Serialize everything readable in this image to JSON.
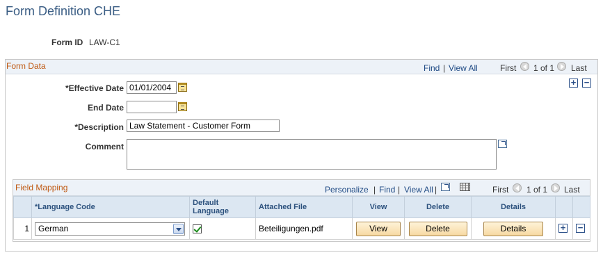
{
  "page": {
    "title": "Form Definition CHE"
  },
  "form_id": {
    "label": "Form ID",
    "value": "LAW-C1"
  },
  "form_data": {
    "title": "Form Data",
    "nav": {
      "find": "Find",
      "separator": "|",
      "view_all": "View All",
      "first": "First",
      "range": "1 of 1",
      "last": "Last"
    },
    "effective_date": {
      "label": "*Effective Date",
      "value": "01/01/2004"
    },
    "end_date": {
      "label": "End Date",
      "value": ""
    },
    "description": {
      "label": "*Description",
      "value": "Law Statement - Customer Form"
    },
    "comment": {
      "label": "Comment",
      "value": ""
    }
  },
  "field_mapping": {
    "title": "Field Mapping",
    "nav": {
      "personalize": "Personalize",
      "separator": "|",
      "find": "Find",
      "view_all": "View All",
      "first": "First",
      "range": "1 of 1",
      "last": "Last"
    },
    "columns": {
      "language_code": "*Language Code",
      "default_language": "Default Language",
      "attached_file": "Attached File",
      "view": "View",
      "delete": "Delete",
      "details": "Details"
    },
    "rows": [
      {
        "num": "1",
        "language": "German",
        "default_language_checked": true,
        "attached_file": "Beteiligungen.pdf",
        "view_label": "View",
        "delete_label": "Delete",
        "details_label": "Details"
      }
    ]
  },
  "icons": {
    "calendar": "calendar-icon",
    "add": "plus",
    "remove": "minus",
    "expand": "expand-icon",
    "grid": "grid-icon",
    "nav_prev": "left-arrow",
    "nav_next": "right-arrow"
  },
  "colors": {
    "title": "#3a5d84",
    "section_title": "#c05a14",
    "link": "#1f4a84",
    "header_bg": "#edf2f8",
    "grid_header_bg": "#dce7f2",
    "button_bg": "#f7d9a2"
  }
}
